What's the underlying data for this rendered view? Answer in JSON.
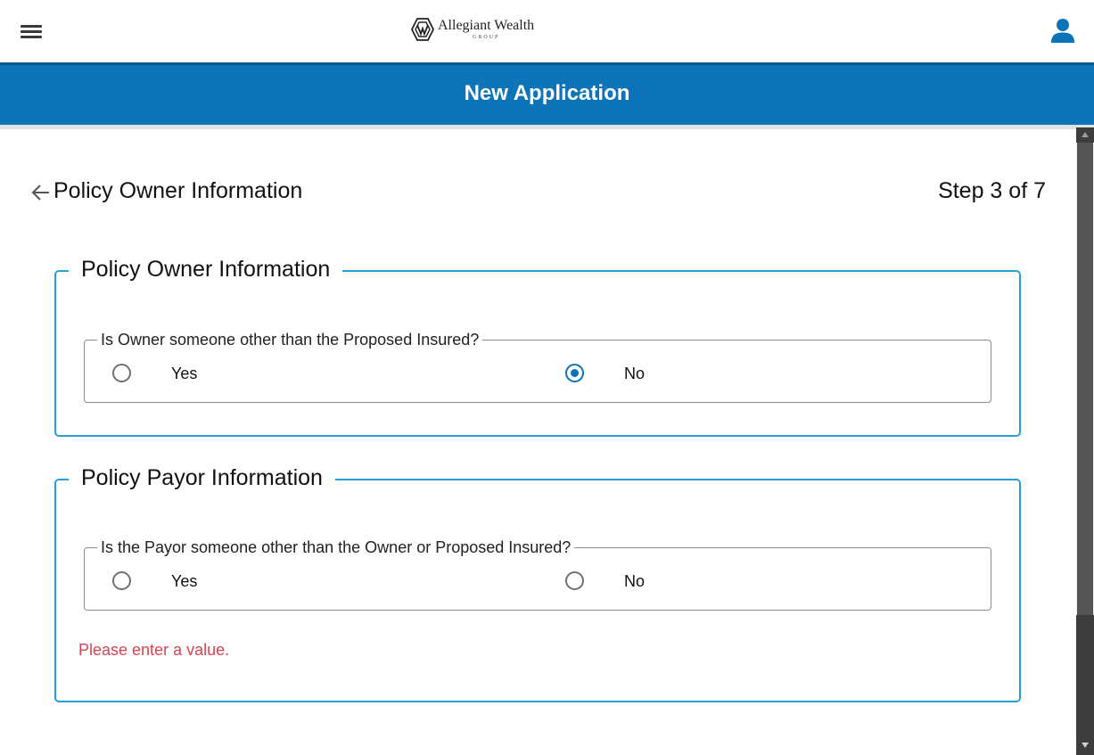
{
  "header": {
    "menu_icon": "hamburger-icon",
    "logo_name": "Allegiant Wealth",
    "logo_sub": "GROUP",
    "user_icon": "user-icon"
  },
  "banner": {
    "title": "New Application"
  },
  "page": {
    "heading": "Policy Owner Information",
    "step": "Step 3 of 7",
    "back_icon": "arrow-left-icon"
  },
  "sections": [
    {
      "legend": "Policy Owner Information",
      "question": "Is Owner someone other than the Proposed Insured?",
      "options": [
        {
          "label": "Yes",
          "checked": false
        },
        {
          "label": "No",
          "checked": true
        }
      ]
    },
    {
      "legend": "Policy Payor Information",
      "question": "Is the Payor someone other than the Owner or Proposed Insured?",
      "options": [
        {
          "label": "Yes",
          "checked": false
        },
        {
          "label": "No",
          "checked": false
        }
      ],
      "error": "Please enter a value."
    }
  ],
  "colors": {
    "brand_blue": "#0e74b8",
    "section_border": "#29a0d4",
    "error_red": "#d64550"
  }
}
